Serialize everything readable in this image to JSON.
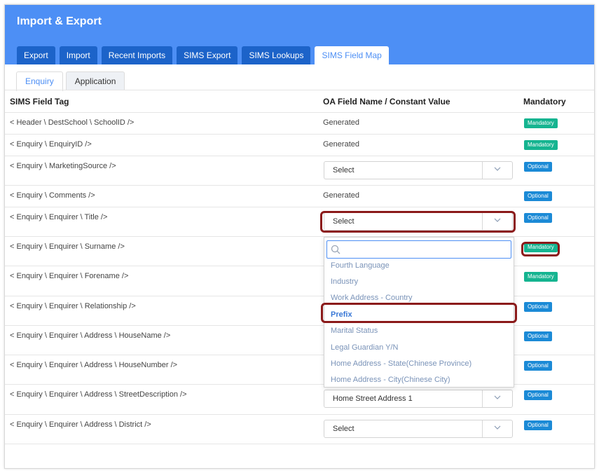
{
  "app": {
    "title": "Import & Export"
  },
  "tabs": [
    {
      "label": "Export"
    },
    {
      "label": "Import"
    },
    {
      "label": "Recent Imports"
    },
    {
      "label": "SIMS Export"
    },
    {
      "label": "SIMS Lookups"
    },
    {
      "label": "SIMS Field Map"
    }
  ],
  "subtabs": [
    {
      "label": "Enquiry"
    },
    {
      "label": "Application"
    }
  ],
  "columns": {
    "tag": "SIMS Field Tag",
    "value": "OA Field Name / Constant Value",
    "mandatory": "Mandatory"
  },
  "rows": [
    {
      "tag": "< Header \\ DestSchool \\ SchoolID />",
      "value": "Generated",
      "badge": "Mandatory"
    },
    {
      "tag": "< Enquiry \\ EnquiryID />",
      "value": "Generated",
      "badge": "Mandatory"
    },
    {
      "tag": "< Enquiry \\ MarketingSource />",
      "select": "Select",
      "badge": "Optional"
    },
    {
      "tag": "< Enquiry \\ Comments />",
      "value": "Generated",
      "badge": "Optional"
    },
    {
      "tag": "< Enquiry \\ Enquirer \\ Title />",
      "select": "Select",
      "badge": "Optional"
    },
    {
      "tag": "< Enquiry \\ Enquirer \\ Surname />",
      "badge": "Mandatory"
    },
    {
      "tag": "< Enquiry \\ Enquirer \\ Forename />",
      "badge": "Mandatory"
    },
    {
      "tag": "< Enquiry \\ Enquirer \\ Relationship />",
      "badge": "Optional"
    },
    {
      "tag": "< Enquiry \\ Enquirer \\ Address \\ HouseName />",
      "badge": "Optional"
    },
    {
      "tag": "< Enquiry \\ Enquirer \\ Address \\ HouseNumber />",
      "badge": "Optional"
    },
    {
      "tag": "< Enquiry \\ Enquirer \\ Address \\ StreetDescription />",
      "select": "Home Street Address 1",
      "badge": "Optional"
    },
    {
      "tag": "< Enquiry \\ Enquirer \\ Address \\ District />",
      "select": "Select",
      "badge": "Optional"
    }
  ],
  "dropdown": {
    "search_placeholder": "",
    "options": [
      "Fourth Language",
      "Industry",
      "Work Address - Country",
      "Prefix",
      "Marital Status",
      "Legal Guardian Y/N",
      "Home Address - State(Chinese Province)",
      "Home Address - City(Chinese City)"
    ],
    "highlighted": "Prefix"
  },
  "colors": {
    "header": "#4d8ff5",
    "tab": "#1c63c9",
    "mandatory": "#15b490",
    "optional": "#1b8ad6",
    "callout": "#8b1a1a"
  },
  "icons": [
    "chevron-down-icon",
    "search-icon"
  ]
}
